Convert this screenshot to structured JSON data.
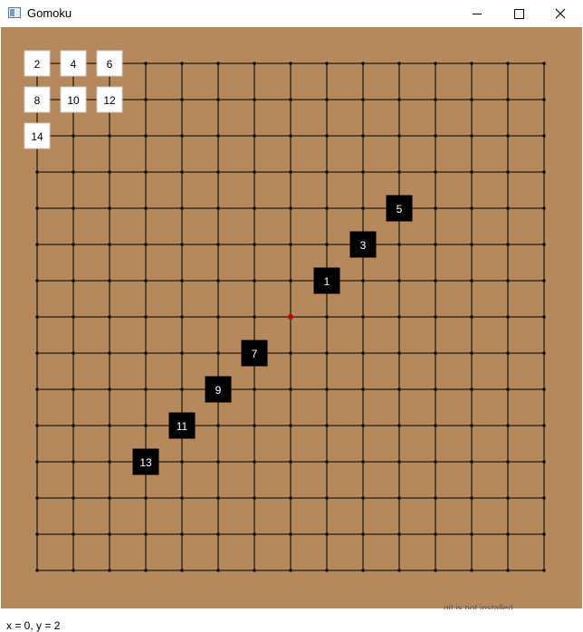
{
  "window": {
    "title": "Gomoku",
    "icon": "window-app-icon",
    "controls": [
      "minimize",
      "maximize",
      "close"
    ]
  },
  "board": {
    "size": 15,
    "background": "#b5895b",
    "grid_color": "#000000",
    "marker_color": "#cc0000",
    "marker": {
      "col": 7,
      "row": 7
    },
    "black_stones": [
      {
        "n": "1",
        "col": 8,
        "row": 6
      },
      {
        "n": "3",
        "col": 9,
        "row": 5
      },
      {
        "n": "5",
        "col": 10,
        "row": 4
      },
      {
        "n": "7",
        "col": 6,
        "row": 8
      },
      {
        "n": "9",
        "col": 5,
        "row": 9
      },
      {
        "n": "11",
        "col": 4,
        "row": 10
      },
      {
        "n": "13",
        "col": 3,
        "row": 11
      }
    ],
    "white_stones": [
      {
        "n": "2",
        "col": 0,
        "row": 0
      },
      {
        "n": "4",
        "col": 1,
        "row": 0
      },
      {
        "n": "6",
        "col": 2,
        "row": 0
      },
      {
        "n": "8",
        "col": 0,
        "row": 1
      },
      {
        "n": "10",
        "col": 1,
        "row": 1
      },
      {
        "n": "12",
        "col": 2,
        "row": 1
      },
      {
        "n": "14",
        "col": 0,
        "row": 2
      }
    ]
  },
  "status": {
    "text": "x = 0, y = 2"
  },
  "background_window": {
    "text": "git is not installed"
  }
}
